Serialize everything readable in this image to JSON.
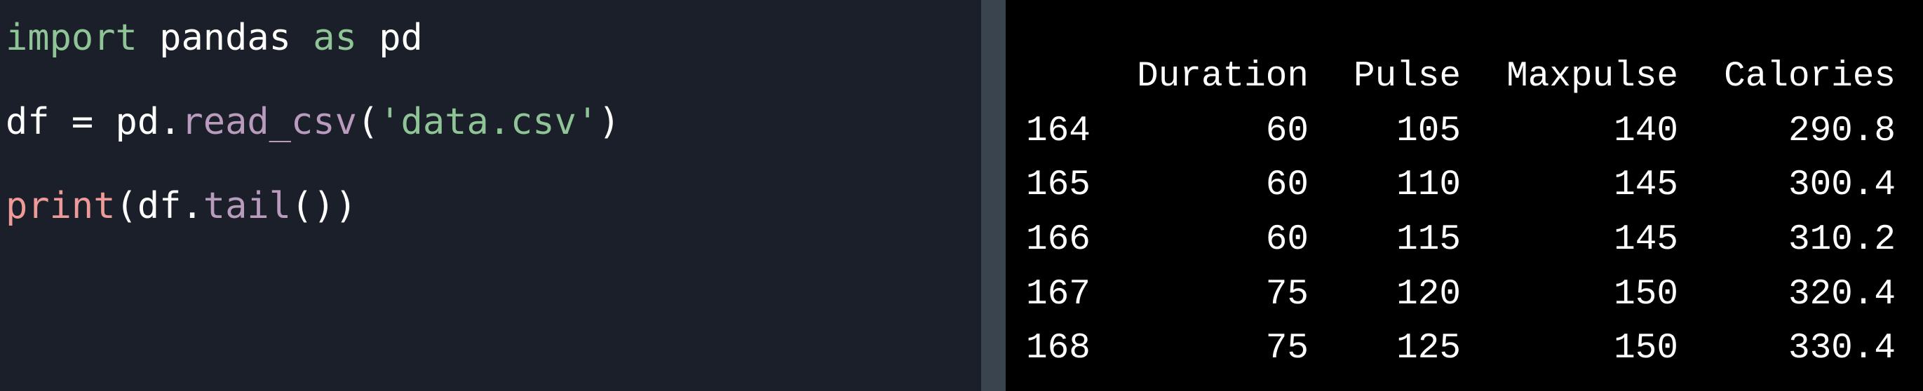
{
  "editor": {
    "lines": [
      {
        "tokens": [
          "import",
          " pandas ",
          "as",
          " pd"
        ]
      },
      {
        "tokens": [
          "df = pd.",
          "read_csv",
          "(",
          "'data.csv'",
          ")"
        ]
      },
      {
        "tokens": [
          "print",
          "(df.",
          "tail",
          "())"
        ]
      }
    ]
  },
  "output": {
    "columns": [
      "",
      "Duration",
      "Pulse",
      "Maxpulse",
      "Calories"
    ],
    "rows": [
      [
        "164",
        "60",
        "105",
        "140",
        "290.8"
      ],
      [
        "165",
        "60",
        "110",
        "145",
        "300.4"
      ],
      [
        "166",
        "60",
        "115",
        "145",
        "310.2"
      ],
      [
        "167",
        "75",
        "120",
        "150",
        "320.4"
      ],
      [
        "168",
        "75",
        "125",
        "150",
        "330.4"
      ]
    ]
  },
  "colors": {
    "editor_bg": "#1a1f29",
    "keyword": "#8fc496",
    "function": "#b99bbd",
    "builtin": "#ee9a98",
    "output_bg": "#000000"
  }
}
